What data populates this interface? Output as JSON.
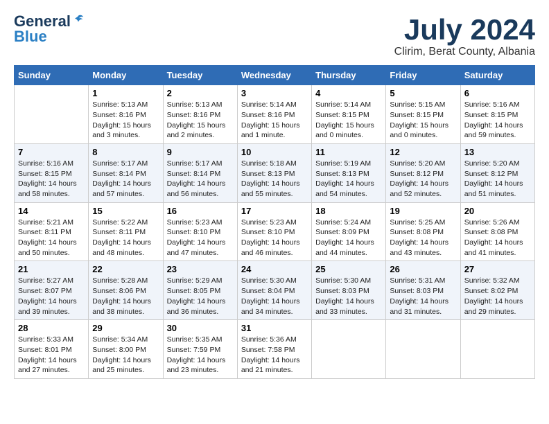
{
  "logo": {
    "general": "General",
    "blue": "Blue"
  },
  "title": "July 2024",
  "location": "Clirim, Berat County, Albania",
  "weekdays": [
    "Sunday",
    "Monday",
    "Tuesday",
    "Wednesday",
    "Thursday",
    "Friday",
    "Saturday"
  ],
  "weeks": [
    [
      {
        "day": "",
        "info": ""
      },
      {
        "day": "1",
        "info": "Sunrise: 5:13 AM\nSunset: 8:16 PM\nDaylight: 15 hours\nand 3 minutes."
      },
      {
        "day": "2",
        "info": "Sunrise: 5:13 AM\nSunset: 8:16 PM\nDaylight: 15 hours\nand 2 minutes."
      },
      {
        "day": "3",
        "info": "Sunrise: 5:14 AM\nSunset: 8:16 PM\nDaylight: 15 hours\nand 1 minute."
      },
      {
        "day": "4",
        "info": "Sunrise: 5:14 AM\nSunset: 8:15 PM\nDaylight: 15 hours\nand 0 minutes."
      },
      {
        "day": "5",
        "info": "Sunrise: 5:15 AM\nSunset: 8:15 PM\nDaylight: 15 hours\nand 0 minutes."
      },
      {
        "day": "6",
        "info": "Sunrise: 5:16 AM\nSunset: 8:15 PM\nDaylight: 14 hours\nand 59 minutes."
      }
    ],
    [
      {
        "day": "7",
        "info": "Sunrise: 5:16 AM\nSunset: 8:15 PM\nDaylight: 14 hours\nand 58 minutes."
      },
      {
        "day": "8",
        "info": "Sunrise: 5:17 AM\nSunset: 8:14 PM\nDaylight: 14 hours\nand 57 minutes."
      },
      {
        "day": "9",
        "info": "Sunrise: 5:17 AM\nSunset: 8:14 PM\nDaylight: 14 hours\nand 56 minutes."
      },
      {
        "day": "10",
        "info": "Sunrise: 5:18 AM\nSunset: 8:13 PM\nDaylight: 14 hours\nand 55 minutes."
      },
      {
        "day": "11",
        "info": "Sunrise: 5:19 AM\nSunset: 8:13 PM\nDaylight: 14 hours\nand 54 minutes."
      },
      {
        "day": "12",
        "info": "Sunrise: 5:20 AM\nSunset: 8:12 PM\nDaylight: 14 hours\nand 52 minutes."
      },
      {
        "day": "13",
        "info": "Sunrise: 5:20 AM\nSunset: 8:12 PM\nDaylight: 14 hours\nand 51 minutes."
      }
    ],
    [
      {
        "day": "14",
        "info": "Sunrise: 5:21 AM\nSunset: 8:11 PM\nDaylight: 14 hours\nand 50 minutes."
      },
      {
        "day": "15",
        "info": "Sunrise: 5:22 AM\nSunset: 8:11 PM\nDaylight: 14 hours\nand 48 minutes."
      },
      {
        "day": "16",
        "info": "Sunrise: 5:23 AM\nSunset: 8:10 PM\nDaylight: 14 hours\nand 47 minutes."
      },
      {
        "day": "17",
        "info": "Sunrise: 5:23 AM\nSunset: 8:10 PM\nDaylight: 14 hours\nand 46 minutes."
      },
      {
        "day": "18",
        "info": "Sunrise: 5:24 AM\nSunset: 8:09 PM\nDaylight: 14 hours\nand 44 minutes."
      },
      {
        "day": "19",
        "info": "Sunrise: 5:25 AM\nSunset: 8:08 PM\nDaylight: 14 hours\nand 43 minutes."
      },
      {
        "day": "20",
        "info": "Sunrise: 5:26 AM\nSunset: 8:08 PM\nDaylight: 14 hours\nand 41 minutes."
      }
    ],
    [
      {
        "day": "21",
        "info": "Sunrise: 5:27 AM\nSunset: 8:07 PM\nDaylight: 14 hours\nand 39 minutes."
      },
      {
        "day": "22",
        "info": "Sunrise: 5:28 AM\nSunset: 8:06 PM\nDaylight: 14 hours\nand 38 minutes."
      },
      {
        "day": "23",
        "info": "Sunrise: 5:29 AM\nSunset: 8:05 PM\nDaylight: 14 hours\nand 36 minutes."
      },
      {
        "day": "24",
        "info": "Sunrise: 5:30 AM\nSunset: 8:04 PM\nDaylight: 14 hours\nand 34 minutes."
      },
      {
        "day": "25",
        "info": "Sunrise: 5:30 AM\nSunset: 8:03 PM\nDaylight: 14 hours\nand 33 minutes."
      },
      {
        "day": "26",
        "info": "Sunrise: 5:31 AM\nSunset: 8:03 PM\nDaylight: 14 hours\nand 31 minutes."
      },
      {
        "day": "27",
        "info": "Sunrise: 5:32 AM\nSunset: 8:02 PM\nDaylight: 14 hours\nand 29 minutes."
      }
    ],
    [
      {
        "day": "28",
        "info": "Sunrise: 5:33 AM\nSunset: 8:01 PM\nDaylight: 14 hours\nand 27 minutes."
      },
      {
        "day": "29",
        "info": "Sunrise: 5:34 AM\nSunset: 8:00 PM\nDaylight: 14 hours\nand 25 minutes."
      },
      {
        "day": "30",
        "info": "Sunrise: 5:35 AM\nSunset: 7:59 PM\nDaylight: 14 hours\nand 23 minutes."
      },
      {
        "day": "31",
        "info": "Sunrise: 5:36 AM\nSunset: 7:58 PM\nDaylight: 14 hours\nand 21 minutes."
      },
      {
        "day": "",
        "info": ""
      },
      {
        "day": "",
        "info": ""
      },
      {
        "day": "",
        "info": ""
      }
    ]
  ]
}
